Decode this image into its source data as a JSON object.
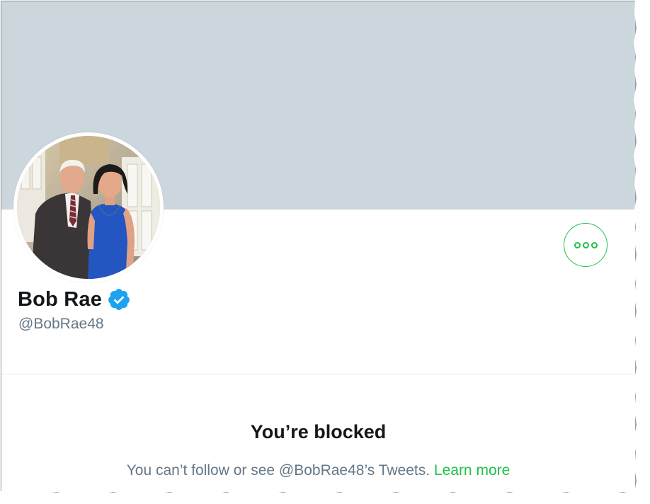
{
  "profile": {
    "display_name": "Bob Rae",
    "handle": "@BobRae48",
    "verified": true
  },
  "colors": {
    "banner": "#ccd6dd",
    "accent": "#1fc14b",
    "verified_badge": "#1da1f2",
    "name_text": "#14171a",
    "secondary_text": "#657786"
  },
  "icons": {
    "more": "more-options-icon",
    "verified": "verified-badge-icon"
  },
  "blocked": {
    "title": "You’re blocked",
    "message": "You can’t follow or see @BobRae48’s Tweets.",
    "link_label": "Learn more"
  }
}
